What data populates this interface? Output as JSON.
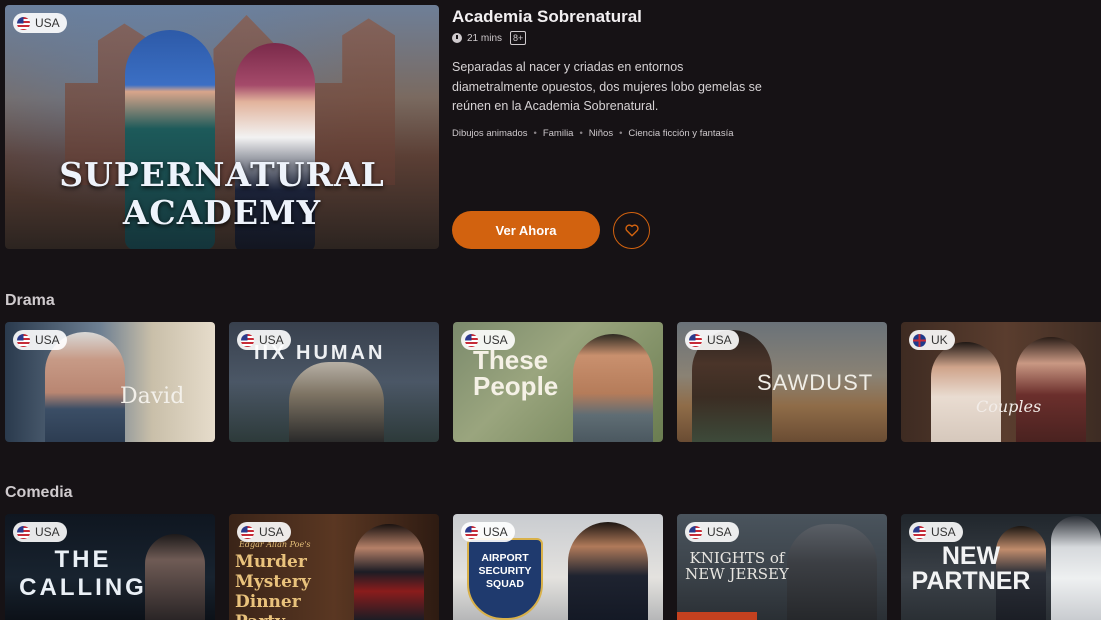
{
  "featured": {
    "country": "USA",
    "poster_title_line1": "SUPERNATURAL",
    "poster_title_line2": "ACADEMY",
    "title": "Academia Sobrenatural",
    "duration": "21 mins",
    "rating": "8+",
    "description": "Separadas al nacer y criadas en entornos diametralmente opuestos, dos mujeres lobo gemelas se reúnen en la Academia Sobrenatural.",
    "genres": [
      "Dibujos animados",
      "Familia",
      "Niños",
      "Ciencia ficción y fantasía"
    ],
    "watch_label": "Ver Ahora",
    "accent_color": "#d2620f"
  },
  "sections": [
    {
      "title": "Drama",
      "items": [
        {
          "country": "USA",
          "title": "David"
        },
        {
          "country": "USA",
          "title": "IIX HUMAN"
        },
        {
          "country": "USA",
          "title": "These People"
        },
        {
          "country": "USA",
          "title": "SAWDUST"
        },
        {
          "country": "UK",
          "title": "Couples"
        }
      ]
    },
    {
      "title": "Comedia",
      "items": [
        {
          "country": "USA",
          "title": "THE CALLING"
        },
        {
          "country": "USA",
          "title": "Murder Mystery Dinner Party",
          "title_top": "Edgar Allan Poe's"
        },
        {
          "country": "USA",
          "title": "AIRPORT SECURITY SQUAD"
        },
        {
          "country": "USA",
          "title": "KNIGHTS of NEW JERSEY"
        },
        {
          "country": "USA",
          "title": "NEW PARTNER"
        }
      ]
    }
  ],
  "icons": {
    "clock": "clock-icon",
    "favorite": "heart-icon",
    "flag_usa": "usa-flag-icon",
    "flag_uk": "uk-flag-icon"
  }
}
